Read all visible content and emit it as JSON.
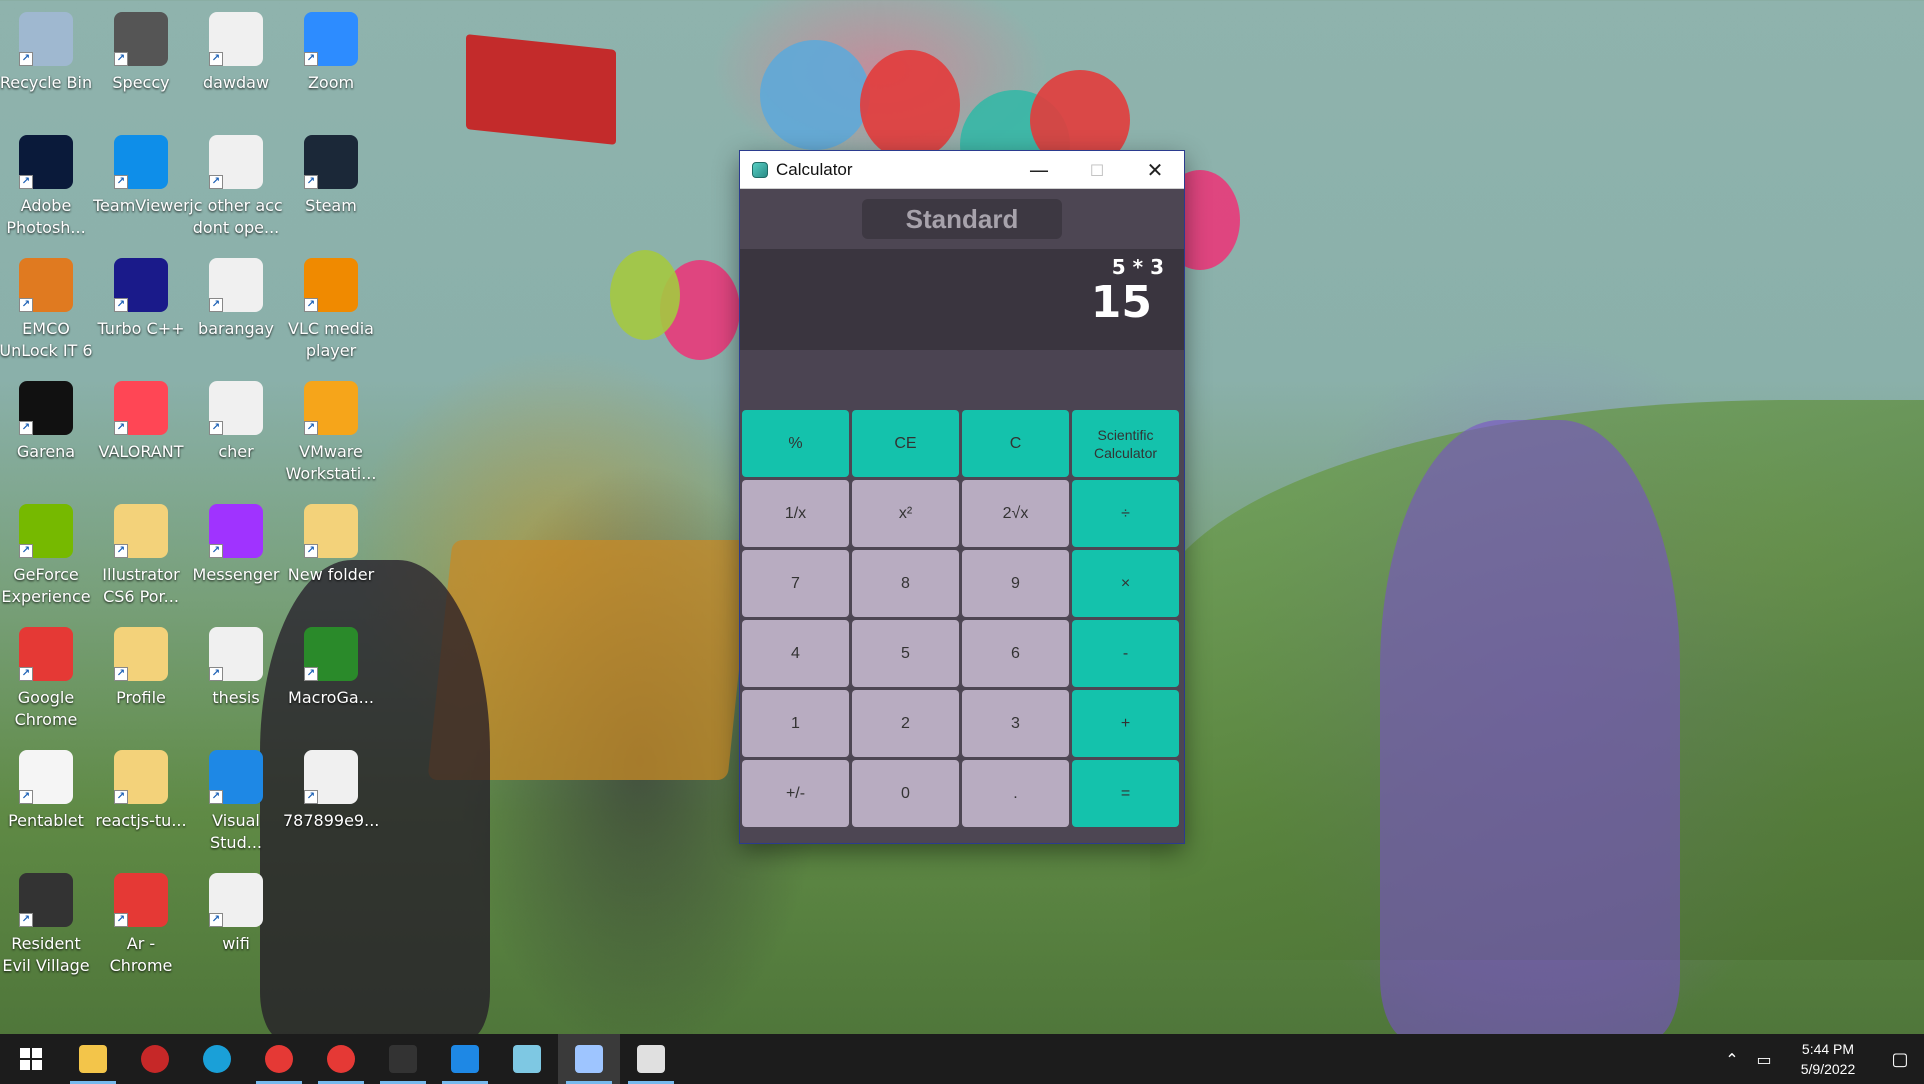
{
  "desktop": {
    "icons": [
      {
        "label": "Recycle Bin",
        "icon": "recycle-bin-icon",
        "color": "#9fb8d0"
      },
      {
        "label": "Speccy",
        "icon": "speccy-icon",
        "color": "#555555"
      },
      {
        "label": "dawdaw",
        "icon": "docx-file-icon",
        "color": "#f0f0f0"
      },
      {
        "label": "Zoom",
        "icon": "zoom-icon",
        "color": "#2d8cff"
      },
      {
        "label": "Adobe Photosh...",
        "icon": "photoshop-icon",
        "color": "#0a1a3a"
      },
      {
        "label": "TeamViewer",
        "icon": "teamviewer-icon",
        "color": "#0e8ee9"
      },
      {
        "label": "jc other acc dont ope...",
        "icon": "file-icon",
        "color": "#f0f0f0"
      },
      {
        "label": "Steam",
        "icon": "steam-icon",
        "color": "#1b2838"
      },
      {
        "label": "EMCO UnLock IT 6",
        "icon": "emco-unlock-icon",
        "color": "#e07a20"
      },
      {
        "label": "Turbo C++",
        "icon": "turbo-cpp-icon",
        "color": "#1a1a8a"
      },
      {
        "label": "barangay",
        "icon": "file-icon",
        "color": "#f0f0f0"
      },
      {
        "label": "VLC media player",
        "icon": "vlc-icon",
        "color": "#f08a00"
      },
      {
        "label": "Garena",
        "icon": "garena-icon",
        "color": "#111111"
      },
      {
        "label": "VALORANT",
        "icon": "valorant-icon",
        "color": "#ff4655"
      },
      {
        "label": "cher",
        "icon": "file-icon",
        "color": "#f0f0f0"
      },
      {
        "label": "VMware Workstati...",
        "icon": "vmware-icon",
        "color": "#f6a51a"
      },
      {
        "label": "GeForce Experience",
        "icon": "geforce-icon",
        "color": "#76b900"
      },
      {
        "label": "Illustrator CS6 Por...",
        "icon": "folder-icon",
        "color": "#f3d27a"
      },
      {
        "label": "Messenger",
        "icon": "messenger-icon",
        "color": "#a033ff"
      },
      {
        "label": "New folder",
        "icon": "folder-icon",
        "color": "#f3d27a"
      },
      {
        "label": "Google Chrome",
        "icon": "chrome-icon",
        "color": "#e53935"
      },
      {
        "label": "Profile",
        "icon": "chrome-profile-folder-icon",
        "color": "#f3d27a"
      },
      {
        "label": "thesis",
        "icon": "file-icon",
        "color": "#f0f0f0"
      },
      {
        "label": "MacroGa...",
        "icon": "macrogamer-icon",
        "color": "#2a8a2a"
      },
      {
        "label": "Pentablet",
        "icon": "pentablet-icon",
        "color": "#f5f5f5"
      },
      {
        "label": "reactjs-tu...",
        "icon": "folder-icon",
        "color": "#f3d27a"
      },
      {
        "label": "Visual Stud...",
        "icon": "vscode-icon",
        "color": "#1e88e5"
      },
      {
        "label": "787899e9...",
        "icon": "file-icon",
        "color": "#f0f0f0"
      },
      {
        "label": "Resident Evil Village",
        "icon": "resident-evil-icon",
        "color": "#333333"
      },
      {
        "label": "Ar - Chrome",
        "icon": "chrome-profile-icon",
        "color": "#e53935"
      },
      {
        "label": "wifi",
        "icon": "file-icon",
        "color": "#f0f0f0"
      }
    ]
  },
  "calculator": {
    "title": "Calculator",
    "controls": {
      "minimize": "—",
      "maximize": "☐",
      "close": "✕"
    },
    "mode": "Standard",
    "expression": "5 * 3",
    "result": "15",
    "colors": {
      "teal": "#14c2ac",
      "grey": "#b8acc1",
      "body": "#4d4653"
    },
    "keys": [
      {
        "label": "%",
        "style": "teal"
      },
      {
        "label": "CE",
        "style": "teal"
      },
      {
        "label": "C",
        "style": "teal"
      },
      {
        "label": "Scientific Calculator",
        "style": "teal"
      },
      {
        "label": "1/x",
        "style": "grey"
      },
      {
        "label": "x²",
        "style": "grey"
      },
      {
        "label": "2√x",
        "style": "grey"
      },
      {
        "label": "÷",
        "style": "teal"
      },
      {
        "label": "7",
        "style": "grey"
      },
      {
        "label": "8",
        "style": "grey"
      },
      {
        "label": "9",
        "style": "grey"
      },
      {
        "label": "×",
        "style": "teal"
      },
      {
        "label": "4",
        "style": "grey"
      },
      {
        "label": "5",
        "style": "grey"
      },
      {
        "label": "6",
        "style": "grey"
      },
      {
        "label": "-",
        "style": "teal"
      },
      {
        "label": "1",
        "style": "grey"
      },
      {
        "label": "2",
        "style": "grey"
      },
      {
        "label": "3",
        "style": "grey"
      },
      {
        "label": "+",
        "style": "teal"
      },
      {
        "label": "+/-",
        "style": "grey"
      },
      {
        "label": "0",
        "style": "grey"
      },
      {
        "label": ".",
        "style": "grey"
      },
      {
        "label": "=",
        "style": "teal"
      }
    ]
  },
  "taskbar": {
    "apps": [
      {
        "name": "file-explorer-icon",
        "color": "#f3c54a",
        "active": true
      },
      {
        "name": "garena-icon",
        "color": "#c62828",
        "active": false
      },
      {
        "name": "edge-icon",
        "color": "#1aa0d8",
        "active": false
      },
      {
        "name": "chrome-icon",
        "color": "#e53935",
        "active": true
      },
      {
        "name": "chrome-profile-icon",
        "color": "#e53935",
        "active": true
      },
      {
        "name": "terminal-icon",
        "color": "#333333",
        "active": true
      },
      {
        "name": "vscode-icon",
        "color": "#1e88e5",
        "active": true
      },
      {
        "name": "notepad-icon",
        "color": "#7ec8e3",
        "active": false
      },
      {
        "name": "python-file-icon",
        "color": "#9ec5ff",
        "active": true
      },
      {
        "name": "paint-icon",
        "color": "#e0e0e0",
        "active": true
      }
    ],
    "time": "5:44 PM",
    "date": "5/9/2022"
  }
}
